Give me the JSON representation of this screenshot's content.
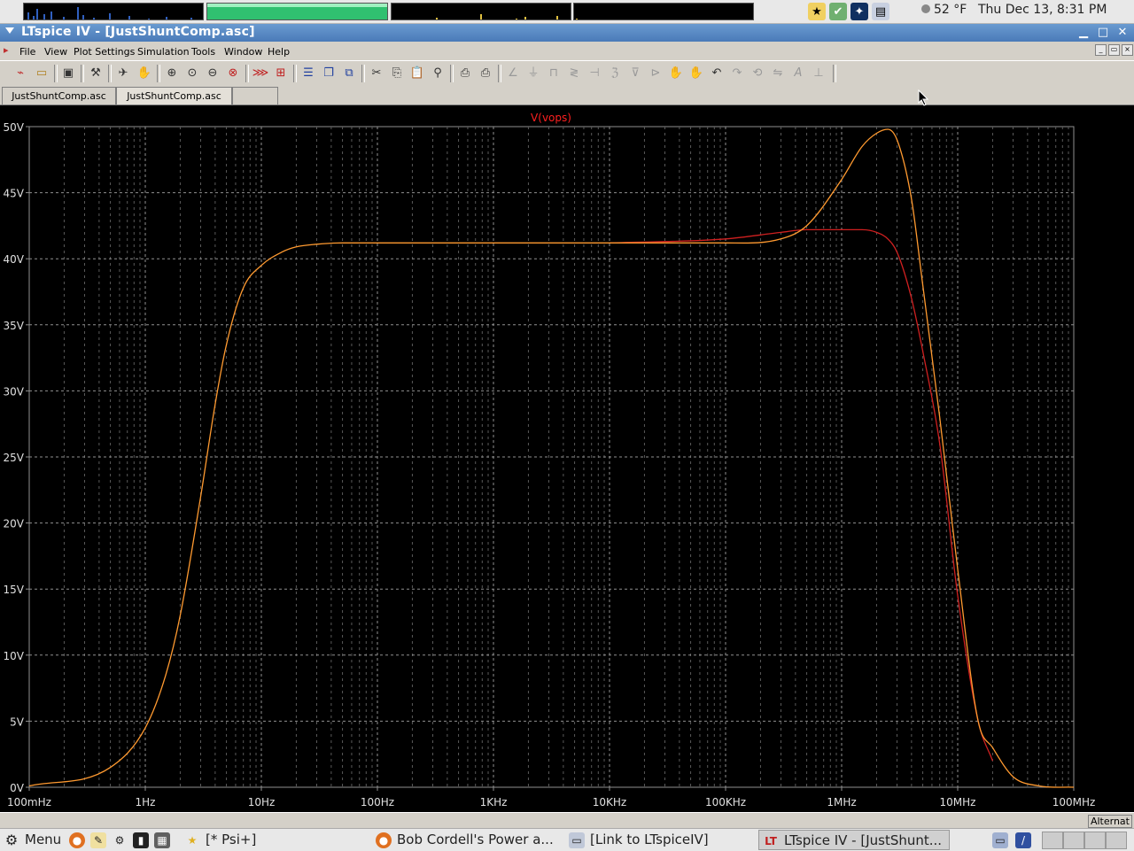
{
  "system_panel": {
    "weather": "52 °F",
    "clock": "Thu Dec 13,  8:31 PM",
    "tray_icons": [
      "star-icon",
      "shield-check-icon",
      "tux-icon",
      "network-icon"
    ]
  },
  "window": {
    "title": "LTspice IV - [JustShuntComp.asc]",
    "controls": [
      "minimize-icon",
      "maximize-icon",
      "close-icon"
    ]
  },
  "menu": [
    "File",
    "View",
    "Plot Settings",
    "Simulation",
    "Tools",
    "Window",
    "Help"
  ],
  "toolbar_icons": [
    "new-schematic-icon",
    "open-icon",
    "save-icon",
    "control-panel-icon",
    "run-icon",
    "pan-icon",
    "zoom-in-icon",
    "zoom-rect-icon",
    "zoom-out-icon",
    "zoom-fit-icon",
    "autorange-icon",
    "grid-icon",
    "tile-horizontal-icon",
    "cascade-icon",
    "tile-vertical-icon",
    "cut-icon",
    "copy-icon",
    "paste-icon",
    "find-icon",
    "print-setup-icon",
    "print-icon",
    "wire-icon",
    "ground-icon",
    "label-icon",
    "resistor-icon",
    "capacitor-icon",
    "inductor-icon",
    "diode-icon",
    "component-icon",
    "move-icon",
    "drag-icon",
    "undo-icon",
    "redo-icon",
    "rotate-icon",
    "mirror-icon",
    "text-icon",
    "spice-directive-icon"
  ],
  "tabs": [
    "JustShuntComp.asc",
    "JustShuntComp.asc",
    ""
  ],
  "plot": {
    "trace_label": "V(vops)",
    "colors": {
      "background": "#000000",
      "grid": "#909090",
      "label": "#ff2020",
      "trace_red": "#d02020",
      "trace_orange": "#ff9a30"
    }
  },
  "chart_data": {
    "type": "line",
    "title": "V(vops)",
    "x_scale": "log",
    "xlim": [
      0.1,
      100000000
    ],
    "ylim": [
      0,
      50
    ],
    "x_ticks": [
      "100mHz",
      "1Hz",
      "10Hz",
      "100Hz",
      "1KHz",
      "10KHz",
      "100KHz",
      "1MHz",
      "10MHz",
      "100MHz"
    ],
    "y_ticks": [
      "0V",
      "5V",
      "10V",
      "15V",
      "20V",
      "25V",
      "30V",
      "35V",
      "40V",
      "45V",
      "50V"
    ],
    "grid": true,
    "series": [
      {
        "color": "#d02020",
        "x": [
          10000,
          100000,
          300000,
          500000,
          1000000,
          1500000,
          2000000,
          2500000,
          3000000,
          4000000,
          5000000,
          7000000,
          10000000,
          15000000,
          20000000
        ],
        "y": [
          41.2,
          41.5,
          42.0,
          42.2,
          42.2,
          42.2,
          42.0,
          41.5,
          40.5,
          37.0,
          33.0,
          26.0,
          14.5,
          5.0,
          2.0
        ]
      },
      {
        "color": "#ff9a30",
        "x": [
          0.1,
          0.5,
          1,
          1.5,
          2,
          3,
          4,
          5,
          7,
          10,
          15,
          20,
          30,
          50,
          100,
          1000,
          10000,
          100000,
          300000,
          500000,
          1000000,
          1500000,
          2000000,
          2500000,
          3000000,
          4000000,
          5000000,
          7000000,
          10000000,
          15000000,
          20000000,
          30000000,
          50000000,
          100000000
        ],
        "y": [
          0.1,
          1.5,
          4.5,
          8.5,
          13.0,
          22.0,
          29.0,
          33.5,
          37.8,
          39.5,
          40.5,
          40.9,
          41.1,
          41.2,
          41.2,
          41.2,
          41.2,
          41.2,
          41.5,
          42.5,
          46.0,
          48.5,
          49.5,
          49.8,
          49.0,
          44.5,
          38.0,
          28.0,
          16.5,
          5.0,
          3.0,
          0.8,
          0.1,
          0.0
        ]
      }
    ]
  },
  "statusbar": {
    "right": "Alternat"
  },
  "taskbar": {
    "menu_label": "Menu",
    "launchers": [
      "firefox-icon",
      "text-editor-icon",
      "settings-icon",
      "terminal-icon",
      "calculator-icon"
    ],
    "tasks": [
      {
        "label": "[* Psi+]",
        "icon": "star-icon"
      },
      {
        "label": "Bob Cordell's Power a...",
        "icon": "firefox-icon"
      },
      {
        "label": "[Link to LTspiceIV]",
        "icon": "folder-icon"
      },
      {
        "label": "LTspice IV - [JustShunt...",
        "icon": "ltspice-icon"
      }
    ]
  }
}
